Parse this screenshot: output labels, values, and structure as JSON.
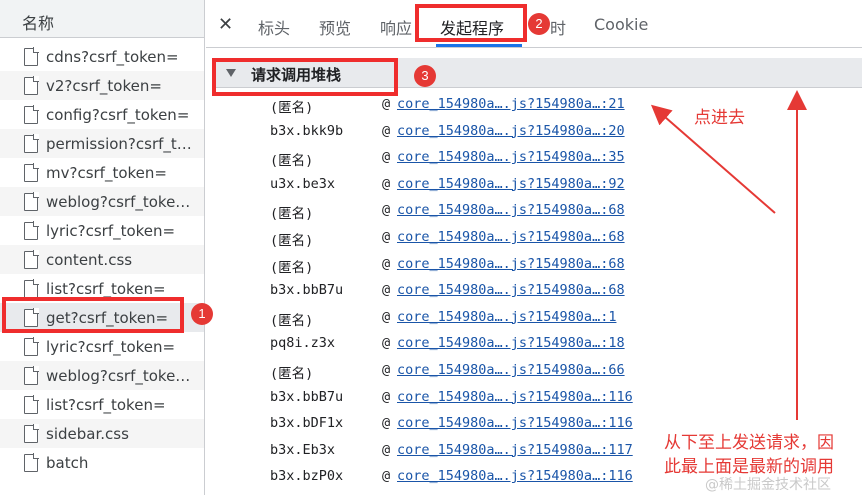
{
  "left_panel": {
    "header": "名称",
    "files": [
      {
        "name": "cdns?csrf_token="
      },
      {
        "name": "v2?csrf_token="
      },
      {
        "name": "config?csrf_token="
      },
      {
        "name": "permission?csrf_to..."
      },
      {
        "name": "mv?csrf_token="
      },
      {
        "name": "weblog?csrf_token="
      },
      {
        "name": "lyric?csrf_token="
      },
      {
        "name": "content.css"
      },
      {
        "name": "list?csrf_token="
      },
      {
        "name": "get?csrf_token="
      },
      {
        "name": "lyric?csrf_token="
      },
      {
        "name": "weblog?csrf_token="
      },
      {
        "name": "list?csrf_token="
      },
      {
        "name": "sidebar.css"
      },
      {
        "name": "batch"
      }
    ]
  },
  "tabs": {
    "close": "✕",
    "items": [
      {
        "label": "标头"
      },
      {
        "label": "预览"
      },
      {
        "label": "响应"
      },
      {
        "label": "发起程序"
      },
      {
        "label": "时"
      },
      {
        "label": "Cookie"
      }
    ]
  },
  "section": {
    "title": "请求调用堆栈"
  },
  "stack": [
    {
      "fn": "(匿名)",
      "at": "@",
      "link": "core_154980a….js?154980a…:21"
    },
    {
      "fn": "b3x.bkk9b",
      "at": "@",
      "link": "core_154980a….js?154980a…:20"
    },
    {
      "fn": "(匿名)",
      "at": "@",
      "link": "core_154980a….js?154980a…:35"
    },
    {
      "fn": "u3x.be3x",
      "at": "@",
      "link": "core_154980a….js?154980a…:92"
    },
    {
      "fn": "(匿名)",
      "at": "@",
      "link": "core_154980a….js?154980a…:68"
    },
    {
      "fn": "(匿名)",
      "at": "@",
      "link": "core_154980a….js?154980a…:68"
    },
    {
      "fn": "(匿名)",
      "at": "@",
      "link": "core_154980a….js?154980a…:68"
    },
    {
      "fn": "b3x.bbB7u",
      "at": "@",
      "link": "core_154980a….js?154980a…:68"
    },
    {
      "fn": "(匿名)",
      "at": "@",
      "link": "core_154980a….js?154980a…:1"
    },
    {
      "fn": "pq8i.z3x",
      "at": "@",
      "link": "core_154980a….js?154980a…:18"
    },
    {
      "fn": "(匿名)",
      "at": "@",
      "link": "core_154980a….js?154980a…:66"
    },
    {
      "fn": "b3x.bbB7u",
      "at": "@",
      "link": "core_154980a….js?154980a…:116"
    },
    {
      "fn": "b3x.bDF1x",
      "at": "@",
      "link": "core_154980a….js?154980a…:116"
    },
    {
      "fn": "b3x.Eb3x",
      "at": "@",
      "link": "core_154980a….js?154980a…:117"
    },
    {
      "fn": "b3x.bzP0x",
      "at": "@",
      "link": "core_154980a….js?154980a…:116"
    }
  ],
  "annotations": {
    "badge1": "1",
    "badge2": "2",
    "badge3": "3",
    "note_click": "点进去",
    "note_order_line1": "从下至上发送请求，因",
    "note_order_line2": "此最上面是最新的调用",
    "watermark": "@稀土掘金技术社区",
    "color": "#e53935"
  }
}
